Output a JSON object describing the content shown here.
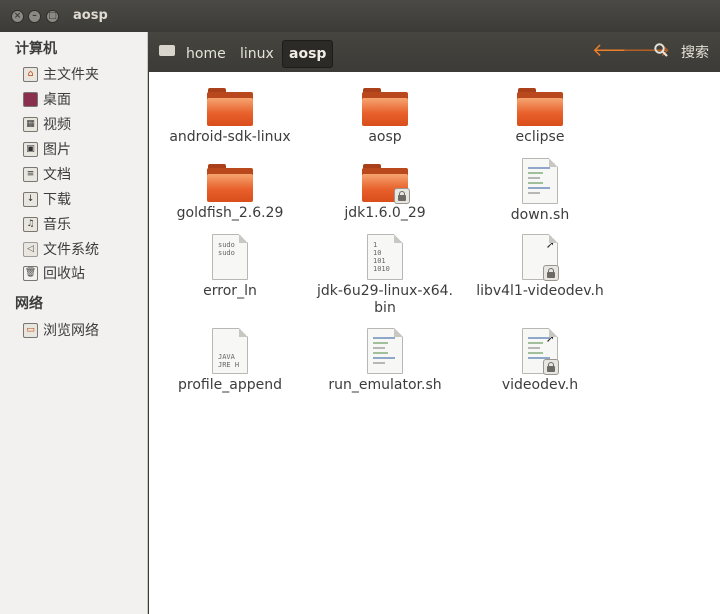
{
  "window": {
    "title": "aosp"
  },
  "sidebar": {
    "computer_heading": "计算机",
    "computer_items": [
      {
        "label": "主文件夹",
        "icon": "home-folder-icon"
      },
      {
        "label": "桌面",
        "icon": "desktop-icon"
      },
      {
        "label": "视频",
        "icon": "videos-icon"
      },
      {
        "label": "图片",
        "icon": "pictures-icon"
      },
      {
        "label": "文档",
        "icon": "documents-icon"
      },
      {
        "label": "下载",
        "icon": "downloads-icon"
      },
      {
        "label": "音乐",
        "icon": "music-icon"
      },
      {
        "label": "文件系统",
        "icon": "filesystem-icon"
      },
      {
        "label": "回收站",
        "icon": "trash-icon"
      }
    ],
    "network_heading": "网络",
    "network_items": [
      {
        "label": "浏览网络",
        "icon": "network-icon"
      }
    ]
  },
  "toolbar": {
    "breadcrumbs": [
      "home",
      "linux",
      "aosp"
    ],
    "search_label": "搜索"
  },
  "files": [
    {
      "name": "android-sdk-linux",
      "type": "folder"
    },
    {
      "name": "aosp",
      "type": "folder"
    },
    {
      "name": "eclipse",
      "type": "folder"
    },
    {
      "name": "goldfish_2.6.29",
      "type": "folder"
    },
    {
      "name": "jdk1.6.0_29",
      "type": "folder-locked"
    },
    {
      "name": "down.sh",
      "type": "script"
    },
    {
      "name": "error_ln",
      "type": "text",
      "preview": "sudo\nsudo"
    },
    {
      "name": "jdk-6u29-linux-x64.\nbin",
      "type": "binary",
      "preview": "1\n10\n101\n1010"
    },
    {
      "name": "libv4l1-videodev.h",
      "type": "link-locked"
    },
    {
      "name": "profile_append",
      "type": "text",
      "preview": "JAVA\nJRE H"
    },
    {
      "name": "run_emulator.sh",
      "type": "script"
    },
    {
      "name": "videodev.h",
      "type": "link-locked-lines"
    }
  ]
}
